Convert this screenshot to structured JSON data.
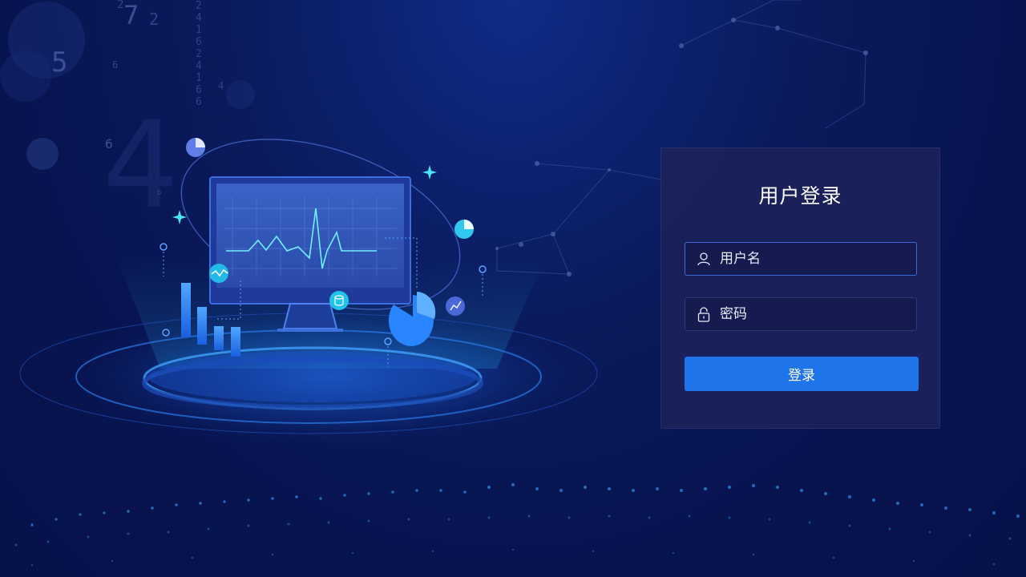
{
  "login": {
    "title": "用户登录",
    "username_placeholder": "用户名",
    "password_placeholder": "密码",
    "submit_label": "登录"
  },
  "decor": {
    "digits": [
      "2",
      "7",
      "2",
      "5",
      "6",
      "4",
      "6",
      "6",
      "4",
      "1"
    ],
    "digit_column": "24162416 6"
  },
  "colors": {
    "accent": "#1f74ea",
    "background": "#0a1a5c",
    "panel": "#1c225a",
    "glow": "#27c2ff"
  }
}
